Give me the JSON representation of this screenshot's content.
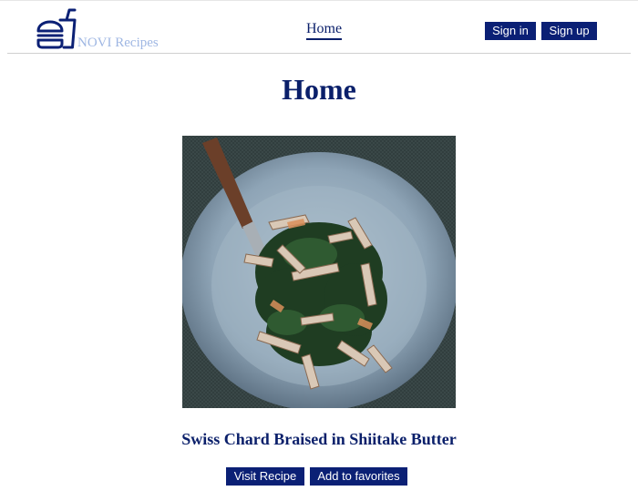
{
  "header": {
    "brand": "NOVI Recipes",
    "logo_icon": "fastfood-icon",
    "nav_home": "Home",
    "sign_in": "Sign in",
    "sign_up": "Sign up"
  },
  "main": {
    "page_title": "Home",
    "recipe": {
      "title": "Swiss Chard Braised in Shiitake Butter",
      "image_alt": "Swiss Chard Braised in Shiitake Butter",
      "visit_label": "Visit Recipe",
      "favorite_label": "Add to favorites"
    }
  },
  "colors": {
    "primary": "#0b2075",
    "brand_text": "#9fb7e3"
  }
}
